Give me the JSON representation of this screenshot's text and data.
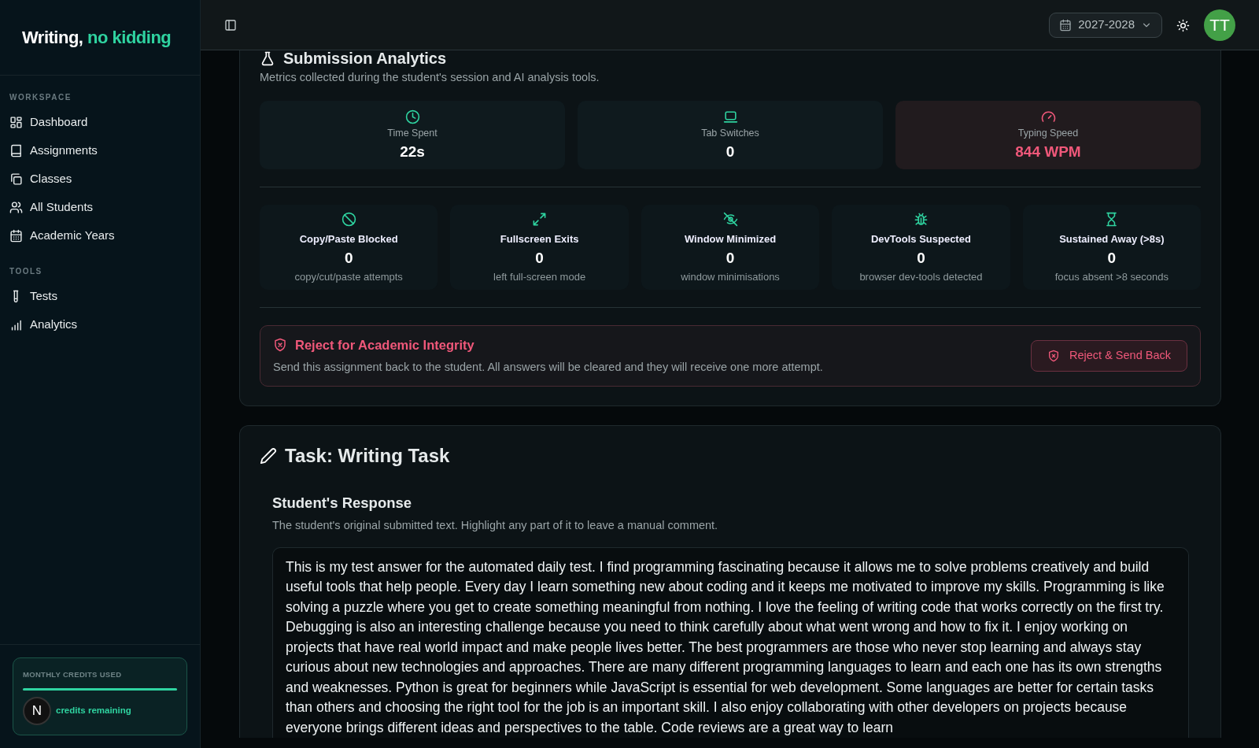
{
  "sidebar": {
    "logo": {
      "text": "Writing,",
      "accent": "no kidding"
    },
    "sections": [
      {
        "heading": "WORKSPACE",
        "items": [
          {
            "label": "Dashboard",
            "selected": false
          },
          {
            "label": "Assignments",
            "selected": false
          },
          {
            "label": "Classes",
            "selected": false
          },
          {
            "label": "All Students",
            "selected": false
          },
          {
            "label": "Academic Years",
            "selected": false
          }
        ]
      },
      {
        "heading": "TOOLS",
        "items": [
          {
            "label": "Tests",
            "selected": false
          },
          {
            "label": "Analytics",
            "selected": false
          }
        ]
      }
    ],
    "credits": {
      "label": "MONTHLY CREDITS USED",
      "level": 1,
      "text": "credits remaining"
    },
    "dev_badge": "N"
  },
  "header": {
    "year": "2027-2028",
    "avatar": "TT"
  },
  "analytics": {
    "title": "Submission Analytics",
    "description": "Metrics collected during the student's session and AI analysis tools.",
    "summary": [
      {
        "label": "Time Spent",
        "value": "22s",
        "flagged": false
      },
      {
        "label": "Tab Switches",
        "value": "0",
        "flagged": false
      },
      {
        "label": "Typing Speed",
        "value": "844 WPM",
        "flagged": true
      }
    ],
    "events": [
      {
        "label": "Copy/Paste Blocked",
        "value": "0",
        "note": "copy/cut/paste attempts"
      },
      {
        "label": "Fullscreen Exits",
        "value": "0",
        "note": "left full-screen mode"
      },
      {
        "label": "Window Minimized",
        "value": "0",
        "note": "window minimisations"
      },
      {
        "label": "DevTools Suspected",
        "value": "0",
        "note": "browser dev-tools detected"
      },
      {
        "label": "Sustained Away (>8s)",
        "value": "0",
        "note": "focus absent >8 seconds"
      }
    ],
    "reject": {
      "title": "Reject for Academic Integrity",
      "description": "Send this assignment back to the student. All answers will be cleared and they will receive one more attempt.",
      "button": "Reject & Send Back"
    }
  },
  "task": {
    "title": "Task: Writing Task",
    "response_title": "Student's Response",
    "response_description": "The student's original submitted text. Highlight any part of it to leave a manual comment.",
    "response": "This is my test answer for the automated daily test. I find programming fascinating because it allows me to solve problems creatively and build useful tools that help people. Every day I learn something new about coding and it keeps me motivated to improve my skills. Programming is like solving a puzzle where you get to create something meaningful from nothing. I love the feeling of writing code that works correctly on the first try. Debugging is also an interesting challenge because you need to think carefully about what went wrong and how to fix it. I enjoy working on projects that have real world impact and make people lives better. The best programmers are those who never stop learning and always stay curious about new technologies and approaches. There are many different programming languages to learn and each one has its own strengths and weaknesses. Python is great for beginners while JavaScript is essential for web development. Some languages are better for certain tasks than others and choosing the right tool for the job is an important skill. I also enjoy collaborating with other developers on projects because everyone brings different ideas and perspectives to the table. Code reviews are a great way to learn"
  }
}
